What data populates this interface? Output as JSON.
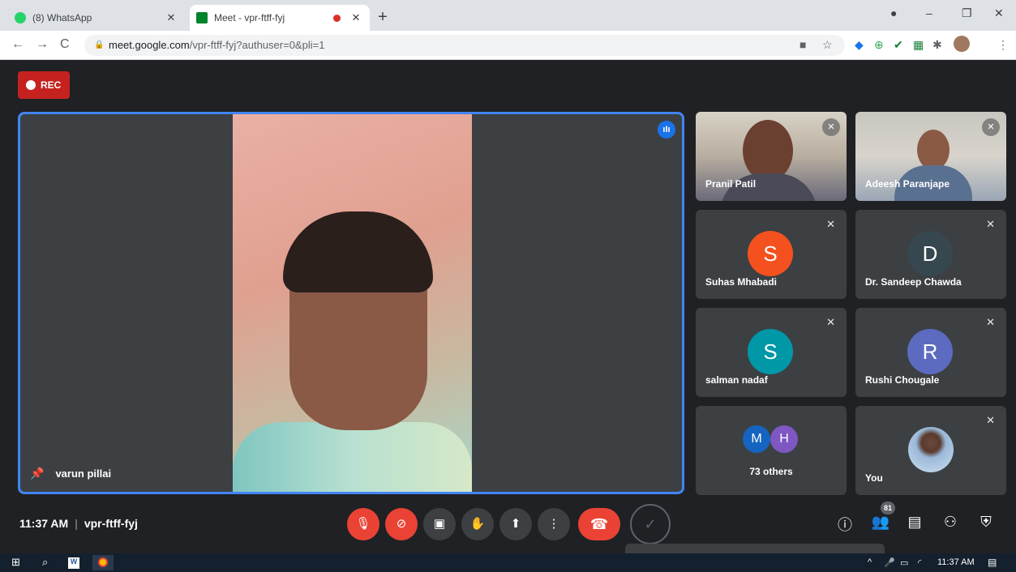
{
  "browser": {
    "tabs": [
      {
        "title": "(8) WhatsApp",
        "close": "✕"
      },
      {
        "title": "Meet - vpr-ftff-fyj",
        "close": "✕"
      }
    ],
    "new_tab": "+",
    "window_controls": {
      "minimize": "–",
      "restore": "❐",
      "close": "✕"
    },
    "url_host": "meet.google.com",
    "url_path": "/vpr-ftff-fyj?authuser=0&pli=1"
  },
  "meet": {
    "rec_label": "REC",
    "main_speaker": "varun pillai",
    "participants": [
      {
        "name": "Pranil Patil"
      },
      {
        "name": "Adeesh Paranjape"
      },
      {
        "name": "Suhas Mhabadi",
        "initial": "S",
        "color": "#f4511e"
      },
      {
        "name": "Dr. Sandeep Chawda",
        "initial": "D",
        "color": "#37474f"
      },
      {
        "name": "salman nadaf",
        "initial": "S",
        "color": "#0097a7"
      },
      {
        "name": "Rushi Chougale",
        "initial": "R",
        "color": "#5c6bc0"
      }
    ],
    "others": {
      "initials": [
        "M",
        "H"
      ],
      "colors": [
        "#1565c0",
        "#7e57c2"
      ],
      "label": "73 others"
    },
    "self_label": "You",
    "meeting_time": "11:37 AM",
    "meeting_code": "vpr-ftff-fyj",
    "people_count": "81"
  },
  "taskbar": {
    "time": "11:37 AM"
  },
  "colors": {
    "accent": "#4285f4",
    "danger": "#ea4335",
    "background": "#202124"
  }
}
